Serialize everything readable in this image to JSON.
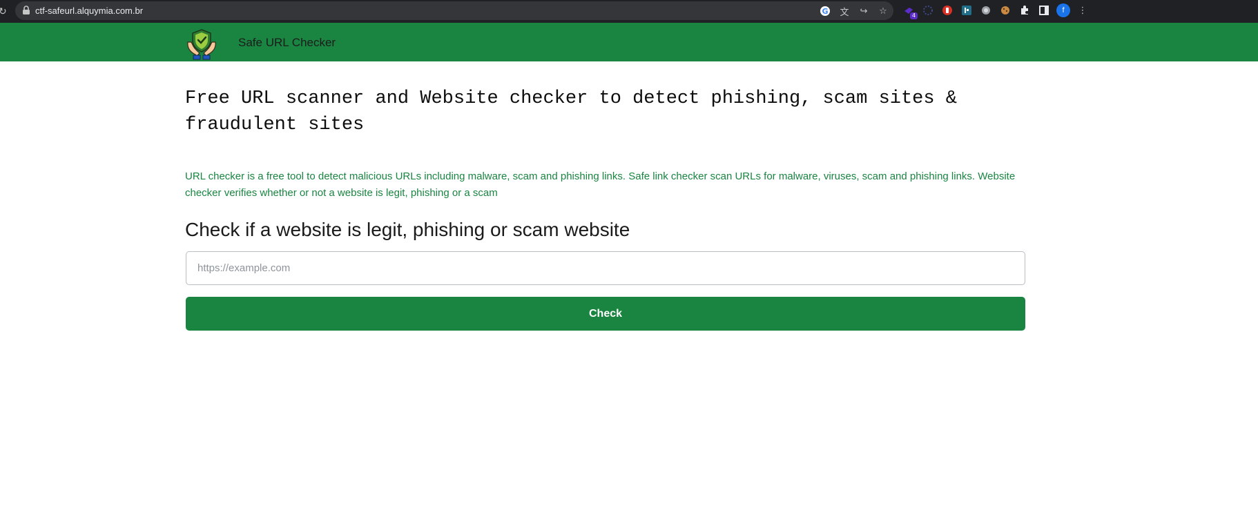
{
  "browser": {
    "url": "ctf-safeurl.alquymia.com.br",
    "extension_badge": "4",
    "profile_initial": "f",
    "icons": [
      "reload-icon",
      "lock-icon",
      "google-icon",
      "translate-icon",
      "share-icon",
      "bookmark-star-icon",
      "extension-icon",
      "puzzle-icon",
      "side-panel-icon",
      "menu-icon"
    ]
  },
  "navbar": {
    "brand_title": "Safe URL Checker",
    "logo": "shield-hands-logo",
    "color": "#198541"
  },
  "main": {
    "headline": "Free URL scanner and Website checker to detect phishing, scam sites & fraudulent sites",
    "intro": "URL checker is a free tool to detect malicious URLs including malware, scam and phishing links. Safe link checker scan URLs for malware, viruses, scam and phishing links. Website checker verifies whether or not a website is legit, phishing or a scam",
    "subheading": "Check if a website is legit, phishing or scam website",
    "url_input": {
      "placeholder": "https://example.com",
      "value": ""
    },
    "check_button_label": "Check"
  }
}
